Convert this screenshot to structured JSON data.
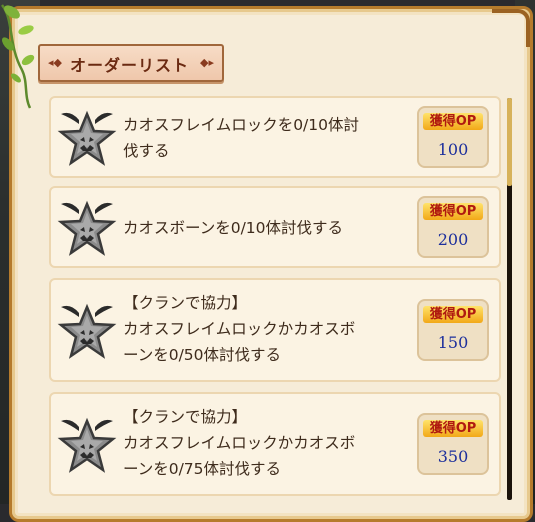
{
  "title": "オーダーリスト",
  "op_label": "獲得OP",
  "orders": [
    {
      "lines": [
        "カオスフレイムロックを0/10体討",
        "伐する"
      ],
      "op": "100"
    },
    {
      "lines": [
        "カオスボーンを0/10体討伐する"
      ],
      "op": "200"
    },
    {
      "lines": [
        "【クランで協力】",
        "カオスフレイムロックかカオスボ",
        "ーンを0/50体討伐する"
      ],
      "op": "150"
    },
    {
      "lines": [
        "【クランで協力】",
        "カオスフレイムロックかカオスボ",
        "ーンを0/75体討伐する"
      ],
      "op": "350"
    }
  ],
  "colors": {
    "panel": "#f6ecd8",
    "border": "#b57b2c",
    "op_value": "#1d2f9c",
    "op_label": "#b01a10"
  },
  "icons": {
    "order_badge": "star-badge-icon",
    "decor": "vine-leaves-icon"
  }
}
